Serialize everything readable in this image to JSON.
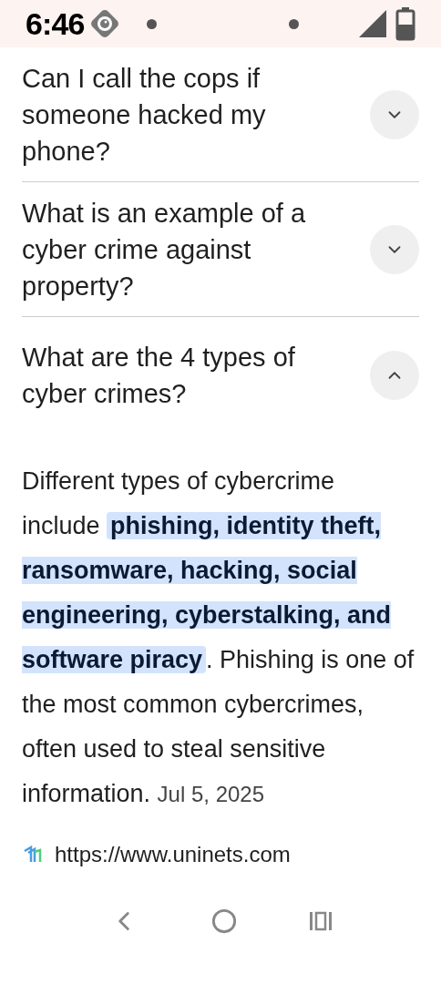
{
  "status_bar": {
    "time": "6:46"
  },
  "questions": [
    {
      "text": "Can I call the cops if someone hacked my phone?",
      "expanded": false
    },
    {
      "text": "What is an example of a cyber crime against property?",
      "expanded": false
    },
    {
      "text": "What are the 4 types of cyber crimes?",
      "expanded": true
    }
  ],
  "answer": {
    "before": "Different types of cybercrime include ",
    "highlight": "phishing, identity theft, ransomware, hacking, social engineering, cyberstalking, and software piracy",
    "after": ". Phishing is one of the most common cybercrimes, often used to steal sensitive information.",
    "date": "Jul 5, 2025"
  },
  "source": {
    "url": "https://www.uninets.com"
  }
}
